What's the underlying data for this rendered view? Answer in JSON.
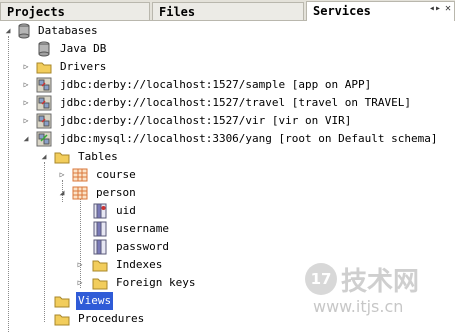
{
  "tabs": [
    {
      "label": "Projects"
    },
    {
      "label": "Files"
    },
    {
      "label": "Services"
    }
  ],
  "tab_controls": {
    "minimize": "◂▸",
    "close": "✕"
  },
  "tree": {
    "databases": "Databases",
    "java_db": "Java DB",
    "drivers": "Drivers",
    "conn_sample": "jdbc:derby://localhost:1527/sample [app on APP]",
    "conn_travel": "jdbc:derby://localhost:1527/travel [travel on TRAVEL]",
    "conn_vir": "jdbc:derby://localhost:1527/vir [vir on VIR]",
    "conn_mysql": "jdbc:mysql://localhost:3306/yang [root on Default schema]",
    "tables": "Tables",
    "course": "course",
    "person": "person",
    "uid": "uid",
    "username": "username",
    "password": "password",
    "indexes": "Indexes",
    "foreign_keys": "Foreign keys",
    "views": "Views",
    "procedures": "Procedures"
  },
  "watermark": {
    "badge": "17",
    "title": "技术网",
    "url": "www.itjs.cn"
  },
  "colors": {
    "selection": "#2f5bd7",
    "folder": "#f2cd5c",
    "table_grid": "#d9773a"
  }
}
